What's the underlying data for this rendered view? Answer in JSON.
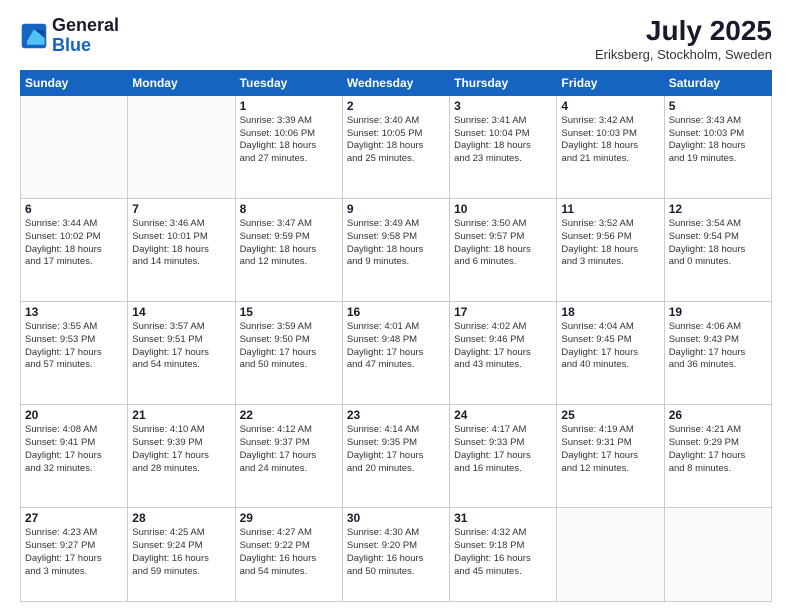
{
  "logo": {
    "line1": "General",
    "line2": "Blue"
  },
  "title": "July 2025",
  "location": "Eriksberg, Stockholm, Sweden",
  "days_header": [
    "Sunday",
    "Monday",
    "Tuesday",
    "Wednesday",
    "Thursday",
    "Friday",
    "Saturday"
  ],
  "weeks": [
    [
      {
        "day": "",
        "text": ""
      },
      {
        "day": "",
        "text": ""
      },
      {
        "day": "1",
        "text": "Sunrise: 3:39 AM\nSunset: 10:06 PM\nDaylight: 18 hours\nand 27 minutes."
      },
      {
        "day": "2",
        "text": "Sunrise: 3:40 AM\nSunset: 10:05 PM\nDaylight: 18 hours\nand 25 minutes."
      },
      {
        "day": "3",
        "text": "Sunrise: 3:41 AM\nSunset: 10:04 PM\nDaylight: 18 hours\nand 23 minutes."
      },
      {
        "day": "4",
        "text": "Sunrise: 3:42 AM\nSunset: 10:03 PM\nDaylight: 18 hours\nand 21 minutes."
      },
      {
        "day": "5",
        "text": "Sunrise: 3:43 AM\nSunset: 10:03 PM\nDaylight: 18 hours\nand 19 minutes."
      }
    ],
    [
      {
        "day": "6",
        "text": "Sunrise: 3:44 AM\nSunset: 10:02 PM\nDaylight: 18 hours\nand 17 minutes."
      },
      {
        "day": "7",
        "text": "Sunrise: 3:46 AM\nSunset: 10:01 PM\nDaylight: 18 hours\nand 14 minutes."
      },
      {
        "day": "8",
        "text": "Sunrise: 3:47 AM\nSunset: 9:59 PM\nDaylight: 18 hours\nand 12 minutes."
      },
      {
        "day": "9",
        "text": "Sunrise: 3:49 AM\nSunset: 9:58 PM\nDaylight: 18 hours\nand 9 minutes."
      },
      {
        "day": "10",
        "text": "Sunrise: 3:50 AM\nSunset: 9:57 PM\nDaylight: 18 hours\nand 6 minutes."
      },
      {
        "day": "11",
        "text": "Sunrise: 3:52 AM\nSunset: 9:56 PM\nDaylight: 18 hours\nand 3 minutes."
      },
      {
        "day": "12",
        "text": "Sunrise: 3:54 AM\nSunset: 9:54 PM\nDaylight: 18 hours\nand 0 minutes."
      }
    ],
    [
      {
        "day": "13",
        "text": "Sunrise: 3:55 AM\nSunset: 9:53 PM\nDaylight: 17 hours\nand 57 minutes."
      },
      {
        "day": "14",
        "text": "Sunrise: 3:57 AM\nSunset: 9:51 PM\nDaylight: 17 hours\nand 54 minutes."
      },
      {
        "day": "15",
        "text": "Sunrise: 3:59 AM\nSunset: 9:50 PM\nDaylight: 17 hours\nand 50 minutes."
      },
      {
        "day": "16",
        "text": "Sunrise: 4:01 AM\nSunset: 9:48 PM\nDaylight: 17 hours\nand 47 minutes."
      },
      {
        "day": "17",
        "text": "Sunrise: 4:02 AM\nSunset: 9:46 PM\nDaylight: 17 hours\nand 43 minutes."
      },
      {
        "day": "18",
        "text": "Sunrise: 4:04 AM\nSunset: 9:45 PM\nDaylight: 17 hours\nand 40 minutes."
      },
      {
        "day": "19",
        "text": "Sunrise: 4:06 AM\nSunset: 9:43 PM\nDaylight: 17 hours\nand 36 minutes."
      }
    ],
    [
      {
        "day": "20",
        "text": "Sunrise: 4:08 AM\nSunset: 9:41 PM\nDaylight: 17 hours\nand 32 minutes."
      },
      {
        "day": "21",
        "text": "Sunrise: 4:10 AM\nSunset: 9:39 PM\nDaylight: 17 hours\nand 28 minutes."
      },
      {
        "day": "22",
        "text": "Sunrise: 4:12 AM\nSunset: 9:37 PM\nDaylight: 17 hours\nand 24 minutes."
      },
      {
        "day": "23",
        "text": "Sunrise: 4:14 AM\nSunset: 9:35 PM\nDaylight: 17 hours\nand 20 minutes."
      },
      {
        "day": "24",
        "text": "Sunrise: 4:17 AM\nSunset: 9:33 PM\nDaylight: 17 hours\nand 16 minutes."
      },
      {
        "day": "25",
        "text": "Sunrise: 4:19 AM\nSunset: 9:31 PM\nDaylight: 17 hours\nand 12 minutes."
      },
      {
        "day": "26",
        "text": "Sunrise: 4:21 AM\nSunset: 9:29 PM\nDaylight: 17 hours\nand 8 minutes."
      }
    ],
    [
      {
        "day": "27",
        "text": "Sunrise: 4:23 AM\nSunset: 9:27 PM\nDaylight: 17 hours\nand 3 minutes."
      },
      {
        "day": "28",
        "text": "Sunrise: 4:25 AM\nSunset: 9:24 PM\nDaylight: 16 hours\nand 59 minutes."
      },
      {
        "day": "29",
        "text": "Sunrise: 4:27 AM\nSunset: 9:22 PM\nDaylight: 16 hours\nand 54 minutes."
      },
      {
        "day": "30",
        "text": "Sunrise: 4:30 AM\nSunset: 9:20 PM\nDaylight: 16 hours\nand 50 minutes."
      },
      {
        "day": "31",
        "text": "Sunrise: 4:32 AM\nSunset: 9:18 PM\nDaylight: 16 hours\nand 45 minutes."
      },
      {
        "day": "",
        "text": ""
      },
      {
        "day": "",
        "text": ""
      }
    ]
  ]
}
